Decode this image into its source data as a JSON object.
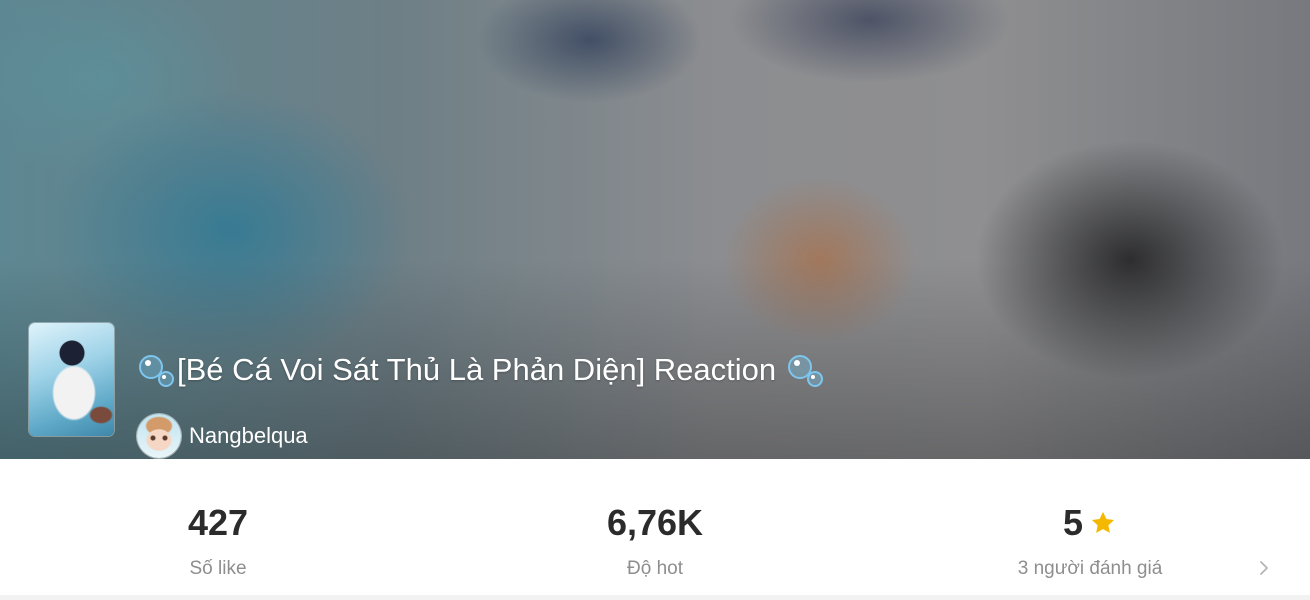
{
  "hero": {
    "title": "[Bé Cá Voi Sát Thủ Là Phản Diện] Reaction",
    "leading_icon": "bubbles-icon",
    "trailing_icon": "bubbles-icon",
    "author": "Nangbelqua"
  },
  "stats": {
    "likes": {
      "value": "427",
      "label": "Số like"
    },
    "hot": {
      "value": "6,76K",
      "label": "Độ hot"
    },
    "rating": {
      "value": "5",
      "label": "3 người đánh giá",
      "icon": "star-icon",
      "star_color": "#f5b800"
    }
  }
}
